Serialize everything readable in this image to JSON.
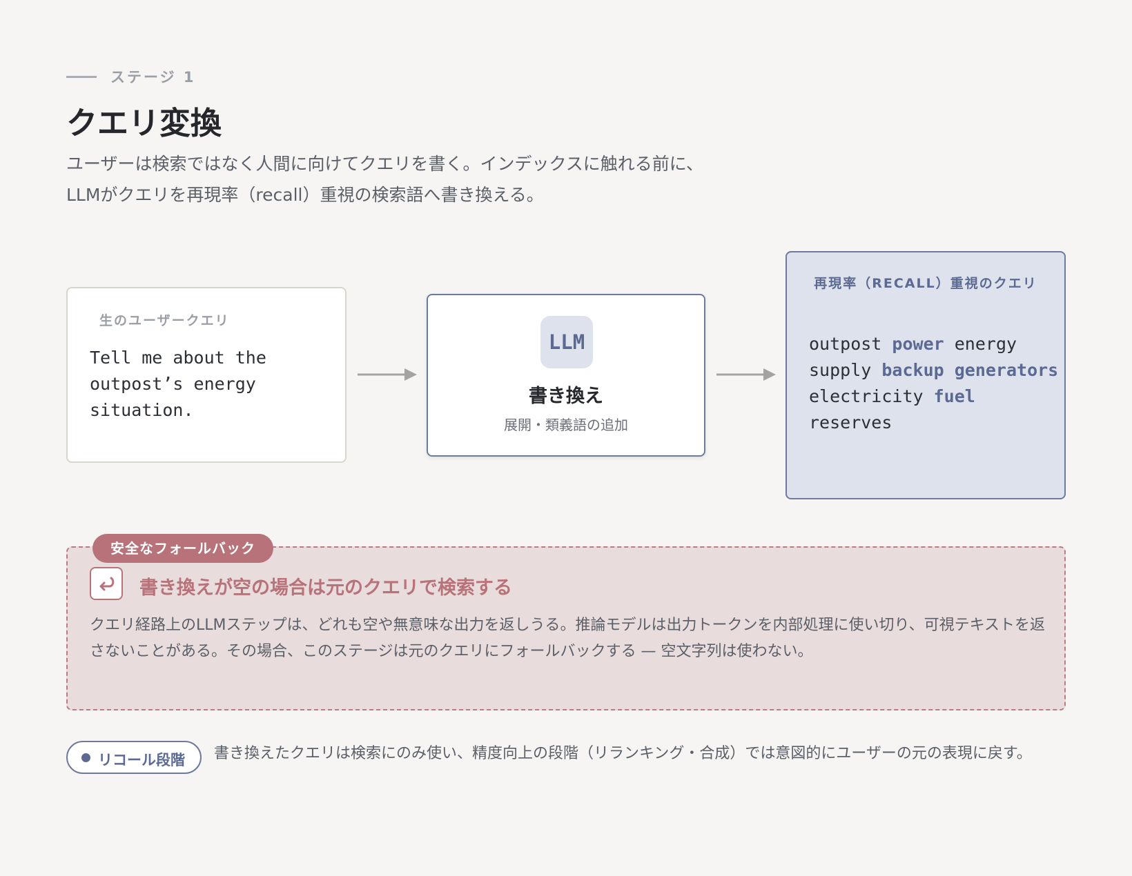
{
  "header": {
    "stage_label": "ステージ 1",
    "title": "クエリ変換",
    "description": "ユーザーは検索ではなく人間に向けてクエリを書く。インデックスに触れる前に、LLMがクエリを再現率（recall）重視の検索語へ書き換える。"
  },
  "raw_card": {
    "caption": "生のユーザークエリ",
    "query": "Tell me about the outpost’s energy situation."
  },
  "llm_card": {
    "badge": "LLM",
    "title": "書き換え",
    "subtitle": "展開・類義語の追加"
  },
  "recall_card": {
    "caption": "再現率（RECALL）重視のクエリ",
    "line1": {
      "a": "outpost ",
      "b": "power",
      "c": " energy"
    },
    "line2": {
      "a": "supply ",
      "b": "backup generators"
    },
    "line3": {
      "a": "electricity ",
      "b": "fuel",
      "c": " reserves"
    }
  },
  "fallback": {
    "tag": "安全なフォールバック",
    "icon": "return-arrow-icon",
    "title": "書き換えが空の場合は元のクエリで検索する",
    "body": "クエリ経路上のLLMステップは、どれも空や無意味な出力を返しうる。推論モデルは出力トークンを内部処理に使い切り、可視テキストを返さないことがある。その場合、このステージは元のクエリにフォールバックする — 空文字列は使わない。"
  },
  "recall_note": {
    "pill_label": "リコール段階",
    "text": "書き換えたクエリは検索にのみ使い、精度向上の段階（リランキング・合成）では意図的にユーザーの元の表現に戻す。"
  },
  "colors": {
    "accent": "#5c6a93",
    "warning": "#b8727a",
    "recall_bg": "#dde2ec",
    "fallback_bg": "#e9dcdd",
    "page_bg": "#f6f5f3"
  }
}
